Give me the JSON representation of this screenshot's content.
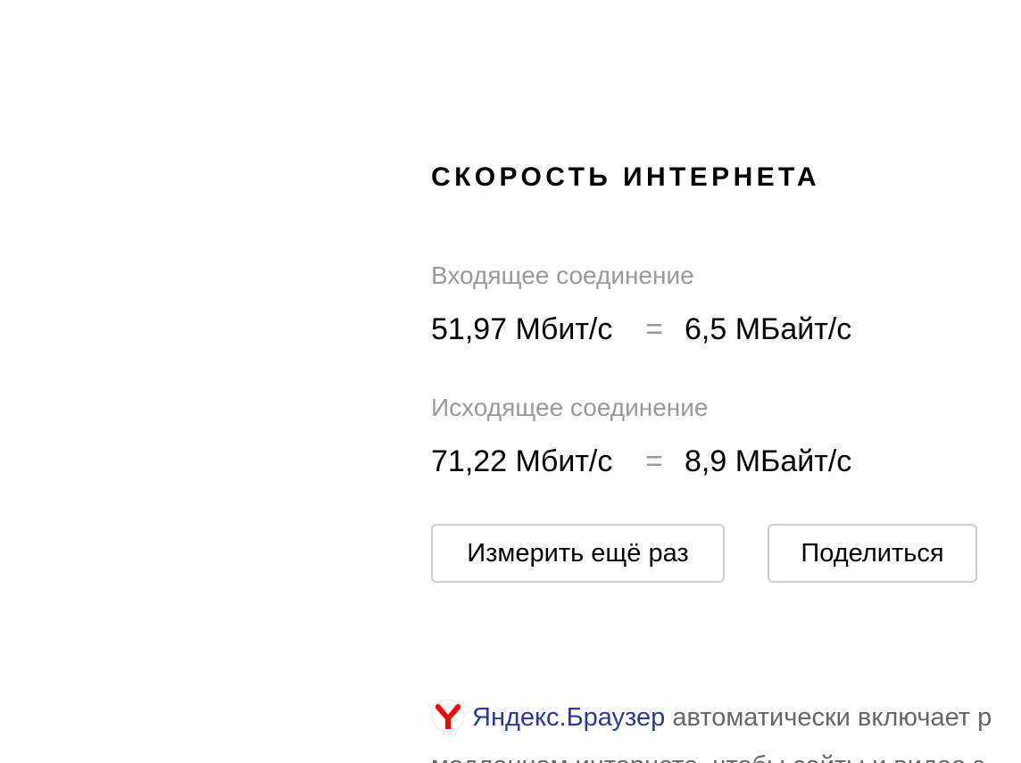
{
  "title": "СКОРОСТЬ ИНТЕРНЕТА",
  "incoming": {
    "label": "Входящее соединение",
    "mbit": "51,97 Мбит/с",
    "equals": "=",
    "mbyte": "6,5 МБайт/с"
  },
  "outgoing": {
    "label": "Исходящее соединение",
    "mbit": "71,22 Мбит/с",
    "equals": "=",
    "mbyte": "8,9 МБайт/с"
  },
  "buttons": {
    "remeasure": "Измерить ещё раз",
    "share": "Поделиться"
  },
  "promo": {
    "icon": "yandex-browser-icon",
    "link_text": "Яндекс.Браузер",
    "text": " автоматически включает р",
    "line2": "медленном интернете, чтобы сайты и видео з"
  },
  "colors": {
    "label_gray": "#999999",
    "link_blue": "#2a3a9a",
    "icon_red": "#ff0000",
    "button_border": "#cccccc"
  }
}
